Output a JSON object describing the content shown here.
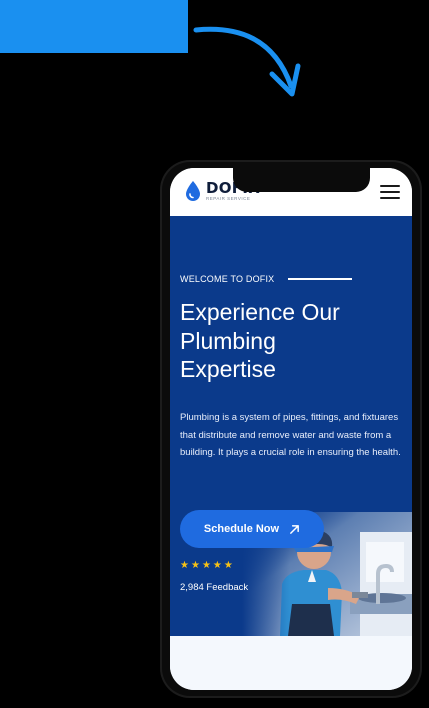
{
  "header": {
    "brand_name": "DOFIX",
    "brand_tagline": "REPAIR SERVICE",
    "logo_icon": "water-drop-icon",
    "menu_icon": "hamburger-menu-icon"
  },
  "hero": {
    "eyebrow": "WELCOME TO DOFIX",
    "title_line1": "Experience Our",
    "title_line2": "Plumbing",
    "title_line3": "Expertise",
    "description": "Plumbing is a system of pipes, fittings, and fixtuares that distribute and remove water and waste from a building. It plays a crucial role in ensuring the health.",
    "cta_label": "Schedule Now",
    "cta_icon": "arrow-up-right-icon",
    "rating_stars": 5,
    "feedback_text": "2,984 Feedback"
  },
  "colors": {
    "tag_blue": "#1a90f0",
    "hero_background": "#0b3a8b",
    "cta_background": "#1f6be0",
    "star_color": "#f6c117"
  }
}
